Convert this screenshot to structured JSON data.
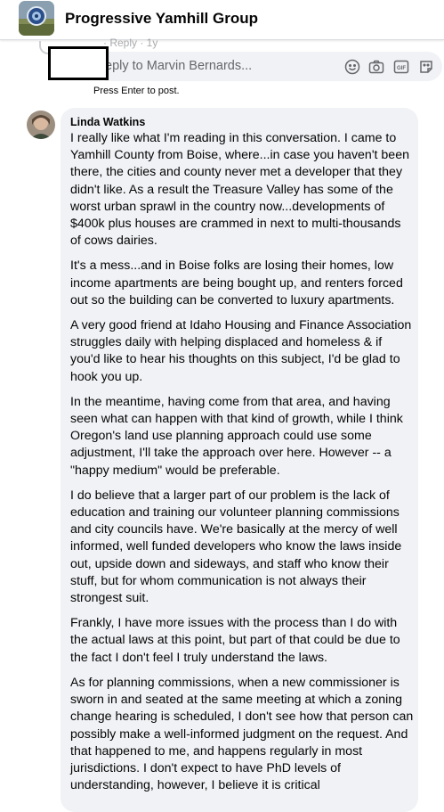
{
  "header": {
    "group_name": "Progressive Yamhill Group"
  },
  "reply": {
    "partial_text_above": "· Reply · 1y",
    "placeholder": "eply to Marvin Bernards...",
    "hint": "Press Enter to post.",
    "icons": [
      "emoji-icon",
      "camera-icon",
      "gif-icon",
      "sticker-icon"
    ]
  },
  "comment": {
    "author": "Linda Watkins",
    "paragraphs": [
      "I really like what I'm reading in this conversation. I came to Yamhill County from Boise, where...in case you haven't been there, the cities and county never met a developer that they didn't like. As a result the Treasure Valley has some of the worst urban sprawl in the country now...developments of $400k plus houses are crammed in next to multi-thousands of cows dairies.",
      "It's a mess...and in Boise folks are losing their homes, low income apartments are being bought up, and renters forced out so the building can be converted to luxury apartments.",
      "A very good friend at Idaho Housing and Finance Association struggles daily with helping displaced and homeless & if you'd like to hear his thoughts on this subject, I'd be glad to hook you up.",
      "In the meantime, having come from that area, and having seen what can happen with that kind of growth, while I think Oregon's land use planning approach could use some adjustment, I'll take the approach over here. However -- a \"happy medium\" would be preferable.",
      "I do believe that a larger part of our problem is the lack of education and training our volunteer planning commissions and city councils have. We're basically at the mercy of well informed, well funded developers who know the laws inside out, upside down and sideways, and staff who know their stuff, but for whom communication is not always their strongest suit.",
      "Frankly, I have more issues with the process than I do with the actual laws at this point, but part of that could be due to the fact I don't feel I truly understand the laws.",
      "As for planning commissions, when a new commissioner is sworn in and seated at the same meeting at which a zoning change hearing is scheduled, I don't see how that person can possibly make a well-informed judgment on the request. And that happened to me, and happens regularly in most jurisdictions. I don't expect to have PhD levels of understanding, however, I believe it is critical"
    ]
  }
}
